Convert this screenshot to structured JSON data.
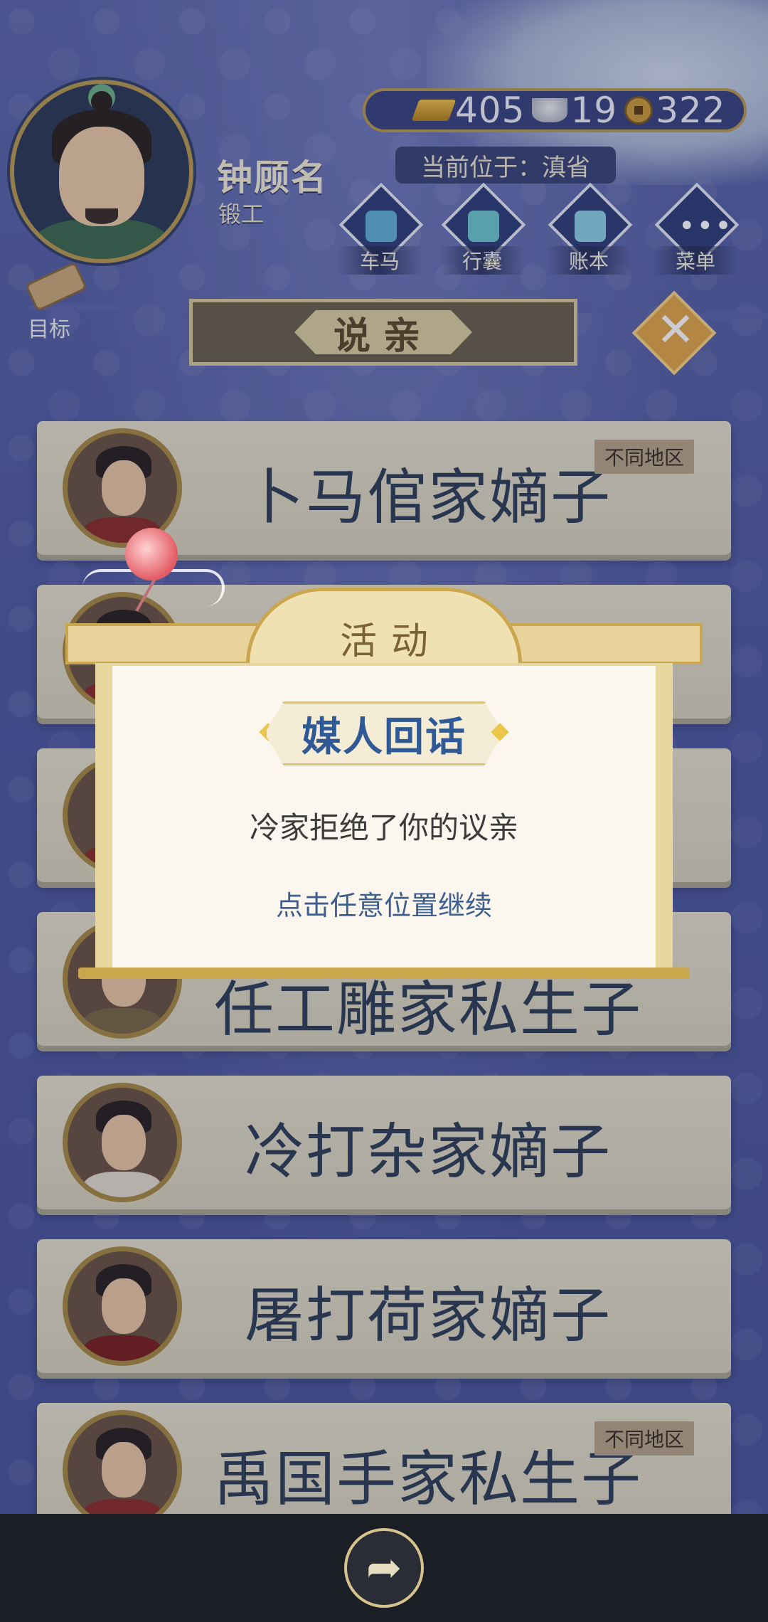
{
  "player": {
    "name": "钟顾名",
    "job": "锻工"
  },
  "currency": {
    "gold": "405",
    "silver": "19",
    "coins": "322"
  },
  "location": "当前位于：滇省",
  "actions": [
    {
      "label": "车马",
      "icon": "carriage-icon"
    },
    {
      "label": "行囊",
      "icon": "bag-icon"
    },
    {
      "label": "账本",
      "icon": "ledger-icon"
    },
    {
      "label": "菜单",
      "icon": "menu-icon"
    }
  ],
  "target_label": "目标",
  "page_title": "说亲",
  "candidates": [
    {
      "name": "卜马倌家嫡子",
      "region_tag": "不同地区"
    },
    {
      "name": "",
      "region_tag": ""
    },
    {
      "name": "",
      "region_tag": ""
    },
    {
      "name": "任工雕家私生子",
      "region_tag": ""
    },
    {
      "name": "冷打杂家嫡子",
      "region_tag": ""
    },
    {
      "name": "屠打荷家嫡子",
      "region_tag": ""
    },
    {
      "name": "禹国手家私生子",
      "region_tag": "不同地区"
    }
  ],
  "dialog": {
    "tag": "活动",
    "headline": "媒人回话",
    "message": "冷家拒绝了你的议亲",
    "hint": "点击任意位置继续"
  },
  "colors": {
    "background": "#5a63a6",
    "gold_trim": "#b89a52",
    "name_text": "#2f4058",
    "headline_blue": "#2f5a96"
  }
}
